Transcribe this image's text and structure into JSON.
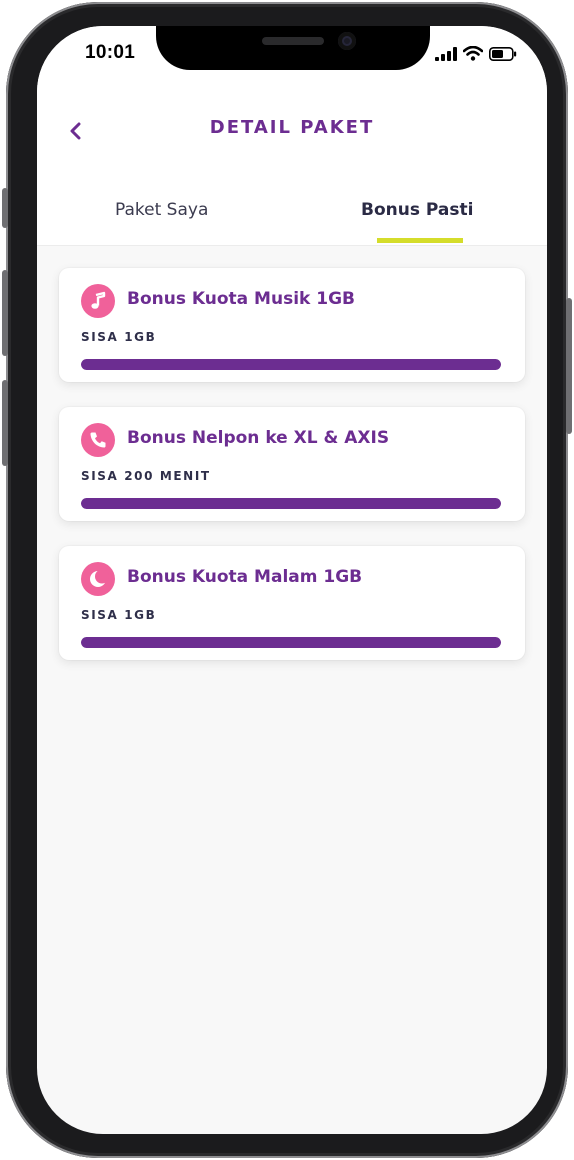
{
  "status_bar": {
    "time": "10:01"
  },
  "header": {
    "title": "DETAIL PAKET",
    "back_icon": "chevron-left-icon"
  },
  "tabs": [
    {
      "label": "Paket Saya",
      "active": false
    },
    {
      "label": "Bonus Pasti",
      "active": true
    }
  ],
  "colors": {
    "primary": "#6c2d91",
    "accent": "#d5dd2b",
    "icon_bg": "#f0619a"
  },
  "bonuses": [
    {
      "title": "Bonus Kuota Musik 1GB",
      "remaining": "SISA 1GB",
      "icon": "music-note-icon",
      "progress": 1.0
    },
    {
      "title": "Bonus Nelpon ke XL & AXIS",
      "remaining": "SISA 200 MENIT",
      "icon": "phone-icon",
      "progress": 1.0
    },
    {
      "title": "Bonus Kuota Malam 1GB",
      "remaining": "SISA 1GB",
      "icon": "moon-icon",
      "progress": 1.0
    }
  ]
}
